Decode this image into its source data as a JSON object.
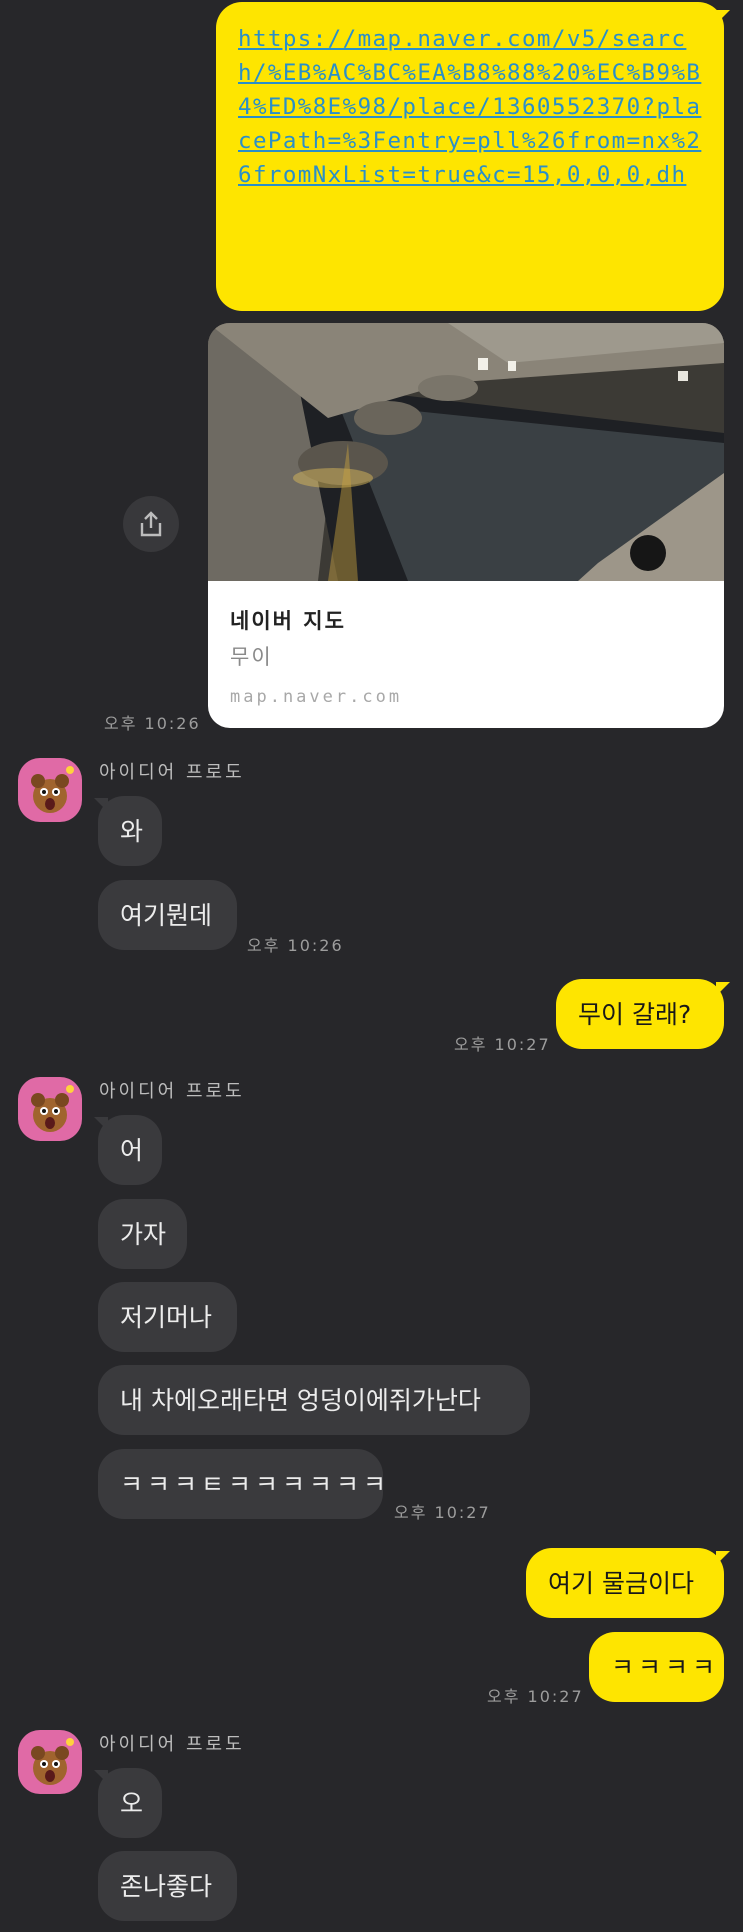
{
  "theme": {
    "background": "#27272a",
    "my_bubble": "#fee500",
    "their_bubble": "#3a3a3d",
    "link_color": "#2a8fc9"
  },
  "link_message": {
    "url": "https://map.naver.com/v5/search/%EB%AC%BC%EA%B8%88%20%EC%B9%B4%ED%8E%98/place/1360552370?placePath=%3Fentry=pll%26from=nx%26fromNxList=true&c=15,0,0,0,dh",
    "preview_title": "네이버 지도",
    "preview_subtitle": "무이",
    "preview_domain": "map.naver.com",
    "time": "오후 10:26",
    "share_icon": "share-icon"
  },
  "contact": {
    "name": "아이디어 프로도",
    "avatar_icon": "frodo-character-avatar"
  },
  "group1": {
    "messages": [
      "와",
      "여기뭔데"
    ],
    "time": "오후 10:26"
  },
  "me1": {
    "message": "무이 갈래?",
    "time": "오후 10:27"
  },
  "group2": {
    "messages": [
      "어",
      "가자",
      "저기머나",
      "내 차에오래타면 엉덩이에쥐가난다",
      "ㅋㅋㅋㅌㅋㅋㅋㅋㅋㅋ"
    ],
    "time": "오후 10:27"
  },
  "me2": {
    "messages": [
      "여기 물금이다",
      "ㅋㅋㅋㅋ"
    ],
    "time": "오후 10:27"
  },
  "group3": {
    "messages": [
      "오",
      "존나좋다"
    ]
  }
}
